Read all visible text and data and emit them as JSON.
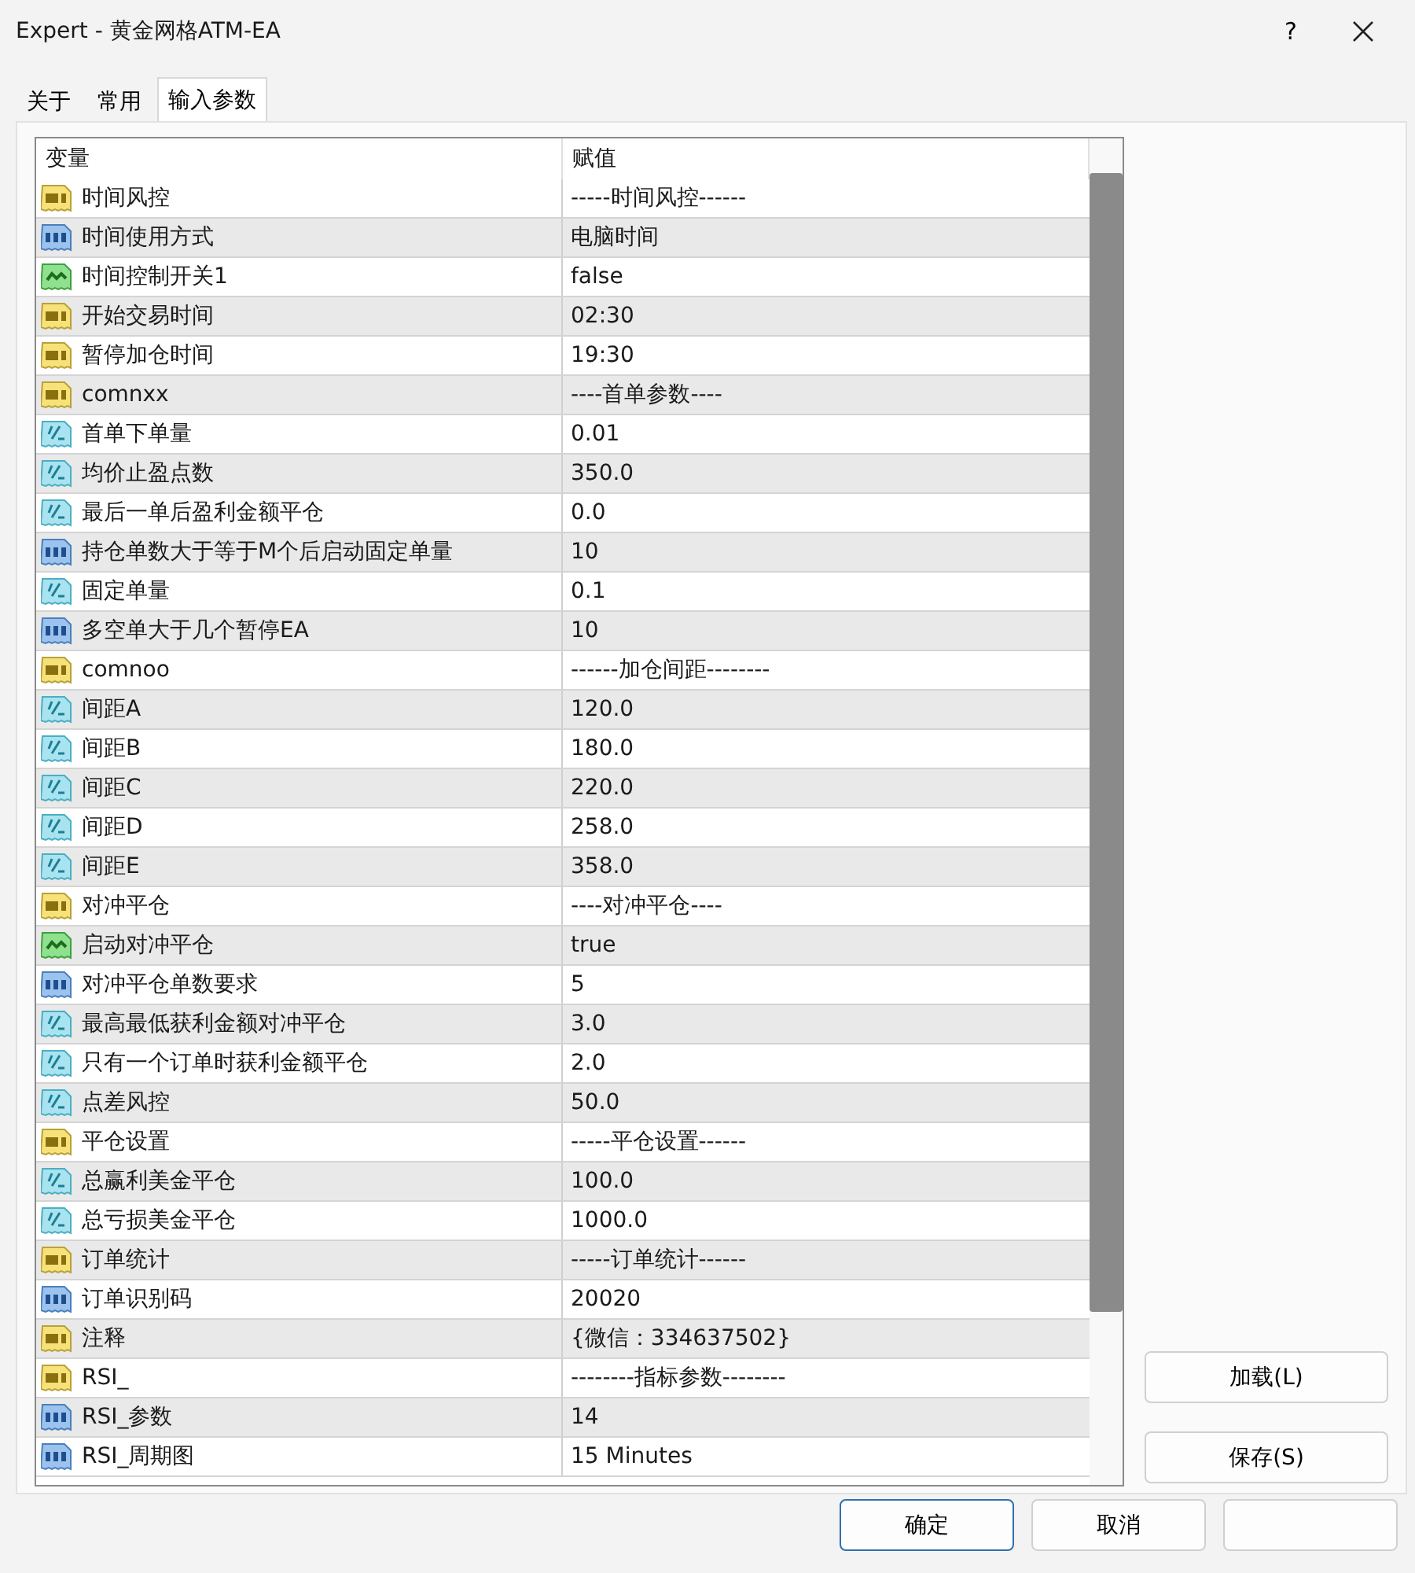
{
  "window": {
    "title": "Expert - 黄金网格ATM-EA",
    "help": "?"
  },
  "tabs": [
    {
      "label": "关于",
      "selected": false
    },
    {
      "label": "常用",
      "selected": false
    },
    {
      "label": "输入参数",
      "selected": true
    }
  ],
  "table": {
    "columns": [
      "变量",
      "赋值"
    ],
    "rows": [
      {
        "kind": "string",
        "name": "时间风控",
        "value": "-----时间风控------"
      },
      {
        "kind": "int",
        "name": "时间使用方式",
        "value": "电脑时间"
      },
      {
        "kind": "bool",
        "name": "时间控制开关1",
        "value": "false"
      },
      {
        "kind": "string",
        "name": "开始交易时间",
        "value": "02:30"
      },
      {
        "kind": "string",
        "name": "暂停加仓时间",
        "value": "19:30"
      },
      {
        "kind": "string",
        "name": "comnxx",
        "value": "----首单参数----"
      },
      {
        "kind": "double",
        "name": "首单下单量",
        "value": "0.01"
      },
      {
        "kind": "double",
        "name": "均价止盈点数",
        "value": "350.0"
      },
      {
        "kind": "double",
        "name": "最后一单后盈利金额平仓",
        "value": "0.0"
      },
      {
        "kind": "int",
        "name": "持仓单数大于等于M个后启动固定单量",
        "value": "10"
      },
      {
        "kind": "double",
        "name": "固定单量",
        "value": "0.1"
      },
      {
        "kind": "int",
        "name": "多空单大于几个暂停EA",
        "value": "10"
      },
      {
        "kind": "string",
        "name": "comnoo",
        "value": "------加仓间距--------"
      },
      {
        "kind": "double",
        "name": "间距A",
        "value": "120.0"
      },
      {
        "kind": "double",
        "name": "间距B",
        "value": "180.0"
      },
      {
        "kind": "double",
        "name": "间距C",
        "value": "220.0"
      },
      {
        "kind": "double",
        "name": "间距D",
        "value": "258.0"
      },
      {
        "kind": "double",
        "name": "间距E",
        "value": "358.0"
      },
      {
        "kind": "string",
        "name": "对冲平仓",
        "value": "----对冲平仓----"
      },
      {
        "kind": "bool",
        "name": "启动对冲平仓",
        "value": "true"
      },
      {
        "kind": "int",
        "name": "对冲平仓单数要求",
        "value": "5"
      },
      {
        "kind": "double",
        "name": "最高最低获利金额对冲平仓",
        "value": "3.0"
      },
      {
        "kind": "double",
        "name": "只有一个订单时获利金额平仓",
        "value": "2.0"
      },
      {
        "kind": "double",
        "name": "点差风控",
        "value": "50.0"
      },
      {
        "kind": "string",
        "name": "平仓设置",
        "value": "-----平仓设置------"
      },
      {
        "kind": "double",
        "name": "总赢利美金平仓",
        "value": "100.0"
      },
      {
        "kind": "double",
        "name": "总亏损美金平仓",
        "value": "1000.0"
      },
      {
        "kind": "string",
        "name": "订单统计",
        "value": "-----订单统计------"
      },
      {
        "kind": "int",
        "name": "订单识别码",
        "value": "20020"
      },
      {
        "kind": "string",
        "name": "注释",
        "value": "{微信：334637502}"
      },
      {
        "kind": "string",
        "name": "RSI_",
        "value": "--------指标参数--------"
      },
      {
        "kind": "int",
        "name": "RSI_参数",
        "value": "14"
      },
      {
        "kind": "int",
        "name": "RSI_周期图",
        "value": "15 Minutes"
      }
    ]
  },
  "side_buttons": [
    "加载(L)",
    "保存(S)"
  ],
  "footer_buttons": [
    {
      "label": "确定",
      "default": true
    },
    {
      "label": "取消",
      "default": false
    },
    {
      "default": false
    }
  ]
}
